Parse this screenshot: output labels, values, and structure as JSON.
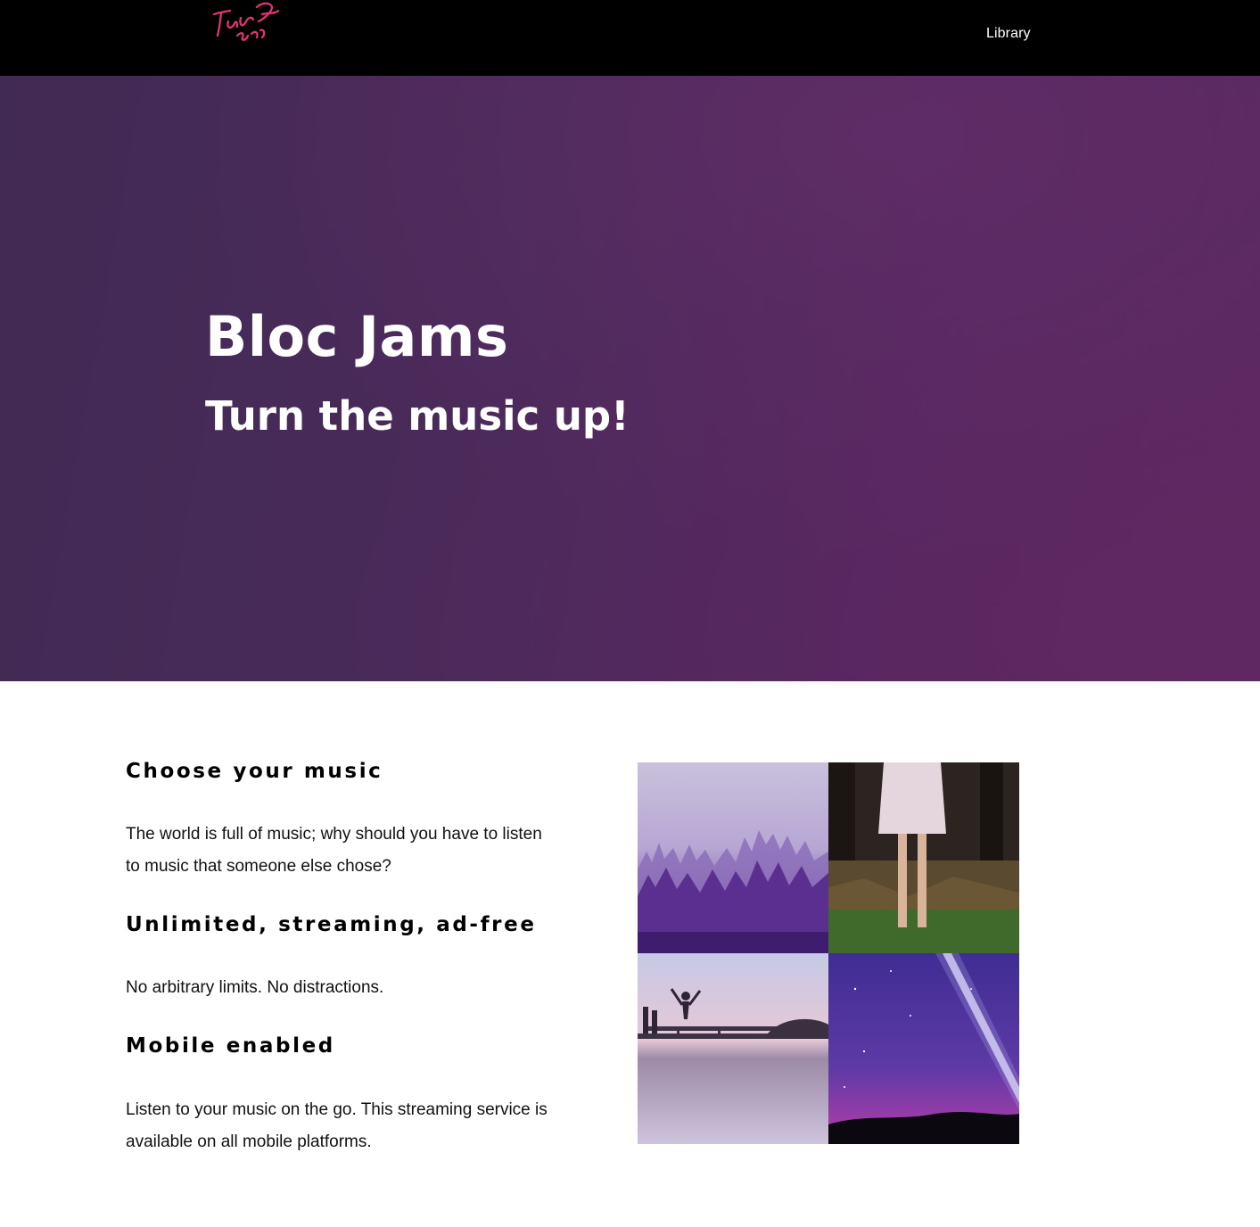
{
  "navbar": {
    "logo_alt": "logo",
    "links": [
      {
        "label": "Library"
      }
    ]
  },
  "hero": {
    "title": "Bloc Jams",
    "subtitle": "Turn the music up!"
  },
  "selling_points": [
    {
      "title": "Choose your music",
      "description": "The world is full of music; why should you have to listen to music that someone else chose?"
    },
    {
      "title": "Unlimited, streaming, ad-free",
      "description": "No arbitrary limits. No distractions."
    },
    {
      "title": "Mobile enabled",
      "description": "Listen to your music on the go. This streaming service is available on all mobile platforms."
    }
  ],
  "image_grid": [
    {
      "name": "misty-forest-image"
    },
    {
      "name": "girl-in-dress-image"
    },
    {
      "name": "lake-jump-image"
    },
    {
      "name": "night-sky-beam-image"
    }
  ],
  "colors": {
    "navbar_bg": "#000000",
    "hero_bg": "#4a2a5a",
    "logo_pink": "#e8337a",
    "text_dark": "#000000",
    "text_light": "#ffffff"
  }
}
